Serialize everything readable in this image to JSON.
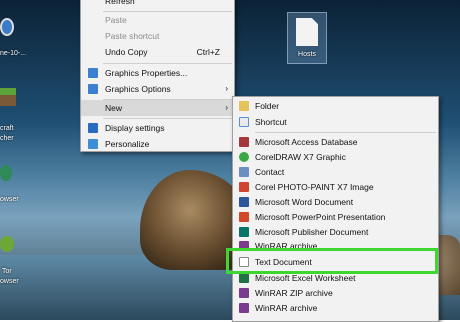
{
  "desktop": {
    "hosts_label": "Hosts",
    "left_icon_labels": [
      "ne-10-...",
      "craft",
      "cher",
      "owser",
      "Tor",
      "owser"
    ]
  },
  "context_menu": {
    "items": [
      {
        "label": "Refresh",
        "state": "normal"
      },
      {
        "label": "Paste",
        "state": "disabled"
      },
      {
        "label": "Paste shortcut",
        "state": "disabled"
      },
      {
        "label": "Undo Copy",
        "shortcut": "Ctrl+Z"
      },
      {
        "label": "Graphics Properties...",
        "icon": "intel-graphics-icon"
      },
      {
        "label": "Graphics Options",
        "icon": "intel-graphics-icon",
        "submenu": true
      },
      {
        "label": "New",
        "submenu": true,
        "state": "highlighted"
      },
      {
        "label": "Display settings",
        "icon": "display-settings-icon"
      },
      {
        "label": "Personalize",
        "icon": "personalize-icon"
      }
    ],
    "arrow_glyph": "›"
  },
  "new_submenu": {
    "items": [
      {
        "label": "Folder",
        "icon": "folder-icon",
        "color": "#e6c35a"
      },
      {
        "label": "Shortcut",
        "icon": "shortcut-icon",
        "color": "#5a8fd6"
      },
      {
        "label": "Microsoft Access Database",
        "icon": "access-icon",
        "color": "#a4373a"
      },
      {
        "label": "CorelDRAW X7 Graphic",
        "icon": "coreldraw-icon",
        "color": "#3aa845"
      },
      {
        "label": "Contact",
        "icon": "contact-icon",
        "color": "#6b8fc2"
      },
      {
        "label": "Corel PHOTO-PAINT X7 Image",
        "icon": "photopaint-icon",
        "color": "#d0452f"
      },
      {
        "label": "Microsoft Word Document",
        "icon": "word-icon",
        "color": "#2b579a"
      },
      {
        "label": "Microsoft PowerPoint Presentation",
        "icon": "powerpoint-icon",
        "color": "#d24726"
      },
      {
        "label": "Microsoft Publisher Document",
        "icon": "publisher-icon",
        "color": "#077568"
      },
      {
        "label": "WinRAR archive",
        "icon": "winrar-icon",
        "color": "#7a3b8f"
      },
      {
        "label": "Text Document",
        "icon": "text-document-icon",
        "color": "#ffffff"
      },
      {
        "label": "Microsoft Excel Worksheet",
        "icon": "excel-icon",
        "color": "#217346"
      },
      {
        "label": "WinRAR ZIP archive",
        "icon": "winrar-zip-icon",
        "color": "#7a3b8f"
      },
      {
        "label": "WinRAR archive",
        "icon": "winrar-icon",
        "color": "#7a3b8f"
      }
    ]
  },
  "highlight_color": "#3ed631"
}
